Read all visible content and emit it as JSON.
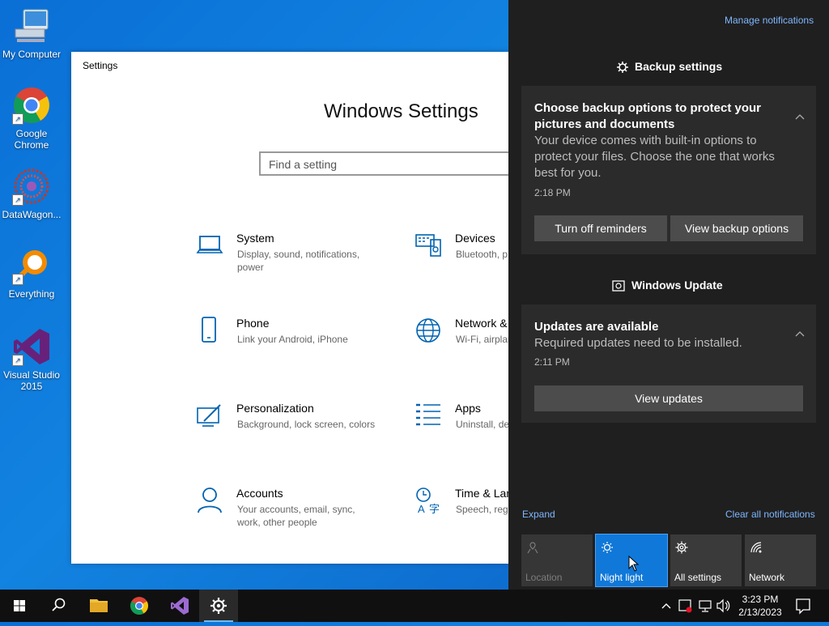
{
  "desktop": {
    "icons": [
      {
        "label": "My Computer"
      },
      {
        "label": "Google Chrome"
      },
      {
        "label": "DataWagon..."
      },
      {
        "label": "Everything"
      },
      {
        "label": "Visual Studio 2015"
      }
    ]
  },
  "settings": {
    "window_title": "Settings",
    "heading": "Windows Settings",
    "search_placeholder": "Find a setting",
    "categories": [
      {
        "name": "System",
        "desc": "Display, sound, notifications, power",
        "icon": "laptop-icon"
      },
      {
        "name": "Devices",
        "desc": "Bluetooth, p",
        "icon": "keyboard-icon"
      },
      {
        "name": "Phone",
        "desc": "Link your Android, iPhone",
        "icon": "phone-icon"
      },
      {
        "name": "Network &",
        "desc": "Wi-Fi, airplan",
        "icon": "globe-icon"
      },
      {
        "name": "Personalization",
        "desc": "Background, lock screen, colors",
        "icon": "paint-icon"
      },
      {
        "name": "Apps",
        "desc": "Uninstall, de features",
        "icon": "apps-list-icon"
      },
      {
        "name": "Accounts",
        "desc": "Your accounts, email, sync, work, other people",
        "icon": "person-icon"
      },
      {
        "name": "Time & Lan",
        "desc": "Speech, regi",
        "icon": "time-language-icon"
      }
    ]
  },
  "action_center": {
    "manage_notifications": "Manage notifications",
    "backup_group": "Backup settings",
    "backup_card": {
      "title": "Choose backup options to protect your pictures and documents",
      "body": "Your device comes with built-in options to protect your files. Choose the one that works best for you.",
      "time": "2:18 PM",
      "btn_reminders": "Turn off reminders",
      "btn_view": "View backup options"
    },
    "update_group": "Windows Update",
    "update_card": {
      "title": "Updates are available",
      "body": "Required updates need to be installed.",
      "time": "2:11 PM",
      "btn_view": "View updates"
    },
    "expand": "Expand",
    "clear_all": "Clear all notifications",
    "tiles": [
      {
        "label": "Location",
        "state": "disabled"
      },
      {
        "label": "Night light",
        "state": "active"
      },
      {
        "label": "All settings",
        "state": "normal"
      },
      {
        "label": "Network",
        "state": "normal"
      }
    ],
    "colors": {
      "accent": "#1078d8",
      "link": "#7fb7ff",
      "panel": "#1f1f1f",
      "card": "#2b2b2b"
    }
  },
  "taskbar": {
    "clock_time": "3:23 PM",
    "clock_date": "2/13/2023"
  }
}
